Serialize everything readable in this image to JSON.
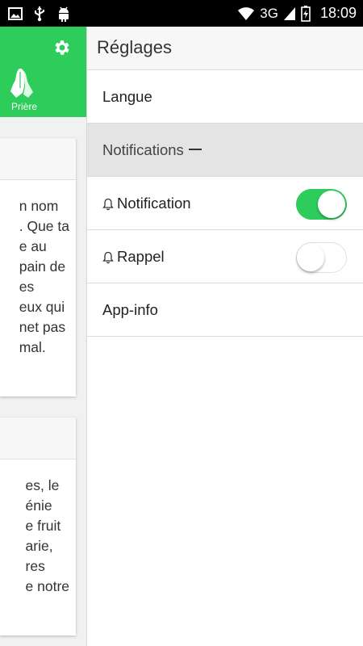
{
  "status_bar": {
    "network": "3G",
    "time": "18:09",
    "icons": [
      "image-icon",
      "usb-icon",
      "android-icon",
      "wifi-icon",
      "signal-icon",
      "battery-icon"
    ]
  },
  "background_app": {
    "header_color": "#2ecc5b",
    "tab_label": "Prière",
    "card1_lines": [
      "n nom",
      ". Que ta",
      "e au",
      "pain de",
      "es",
      "eux qui",
      "net pas",
      "mal."
    ],
    "card2_lines": [
      "es, le",
      "énie",
      "e fruit",
      "arie,",
      "res",
      "e notre"
    ]
  },
  "drawer": {
    "title": "Réglages",
    "items": [
      {
        "label": "Langue"
      },
      {
        "label": "Notifications",
        "section": true
      },
      {
        "label": "Notification",
        "toggle_on": true
      },
      {
        "label": "Rappel",
        "toggle_on": false
      },
      {
        "label": "App-info"
      }
    ]
  },
  "colors": {
    "accent": "#2ecc5b",
    "section_bg": "#e4e4e4"
  }
}
